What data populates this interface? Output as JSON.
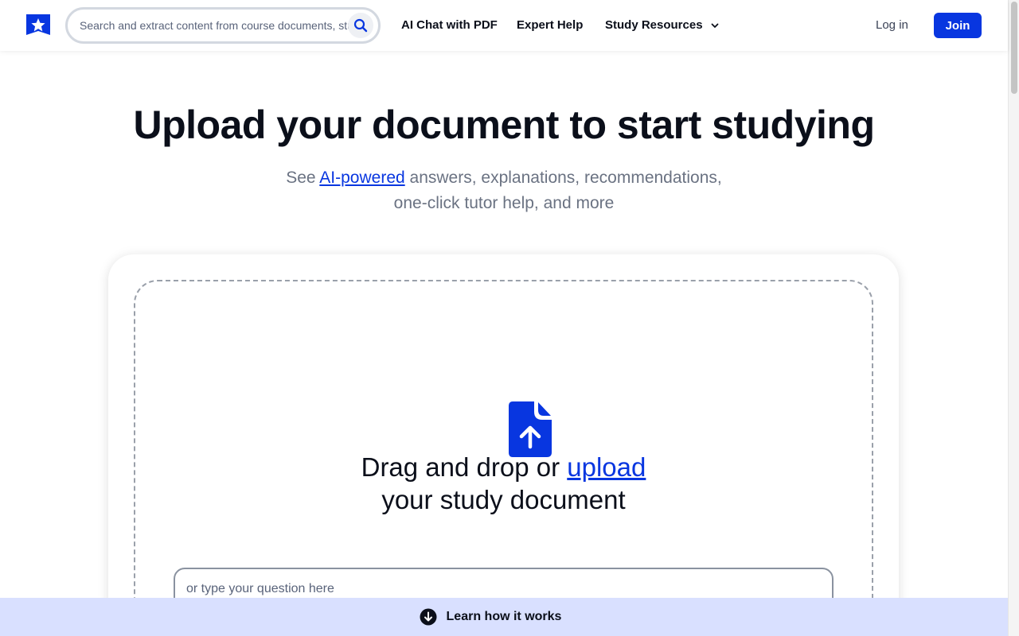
{
  "header": {
    "logo_icon": "shield-star-icon",
    "search_placeholder": "Search and extract content from course documents, study guides",
    "search_icon": "search-icon",
    "nav": {
      "ai_chat": "AI Chat with PDF",
      "expert_help": "Expert Help",
      "study_resources": "Study Resources"
    },
    "login_label": "Log in",
    "join_label": "Join"
  },
  "hero": {
    "title": "Upload your document to start studying",
    "subtitle_prefix": "See ",
    "subtitle_link": "AI-powered",
    "subtitle_rest_line1": " answers, explanations, recommendations,",
    "subtitle_line2": "one-click tutor help, and more"
  },
  "upload": {
    "icon": "document-upload-icon",
    "drop_prefix": "Drag and drop or ",
    "drop_link": "upload",
    "drop_line2": "your study document",
    "question_placeholder": "or type your question here"
  },
  "footer_bar": {
    "icon": "arrow-down-circle-icon",
    "label": "Learn how it works"
  },
  "colors": {
    "brand": "#0836e0",
    "learn_bar_bg": "#d9e0ff",
    "text": "#0b0f1a",
    "muted": "#6a7282"
  }
}
